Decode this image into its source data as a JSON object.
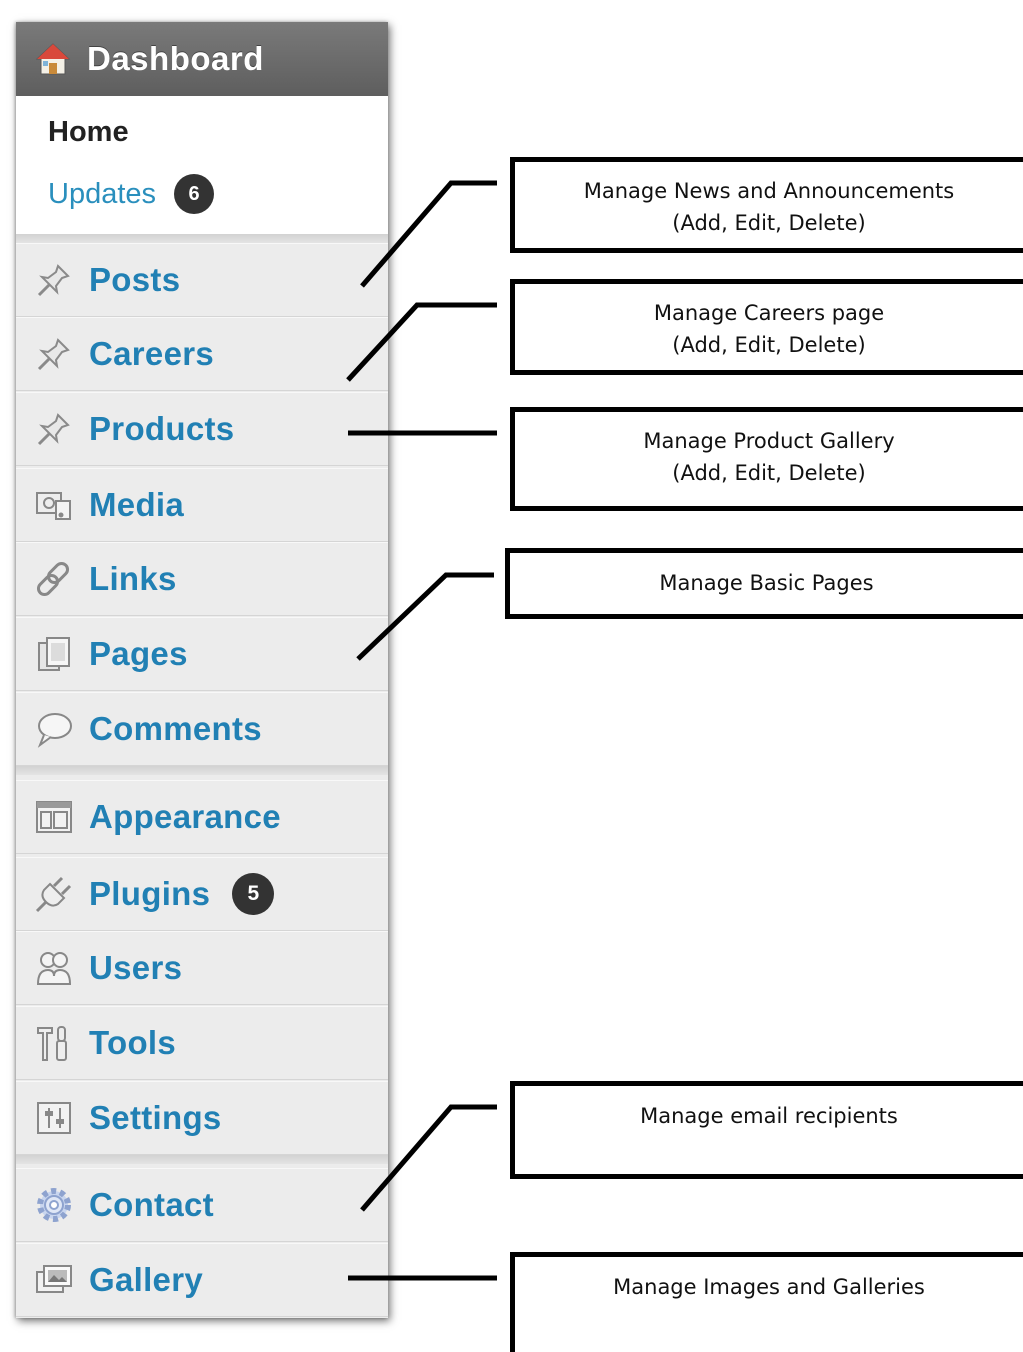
{
  "sidebar": {
    "header": {
      "title": "Dashboard",
      "icon": "home-icon"
    },
    "submenu": {
      "home": "Home",
      "updates": "Updates",
      "updates_badge": "6"
    },
    "items": [
      {
        "label": "Posts",
        "icon": "pushpin-icon"
      },
      {
        "label": "Careers",
        "icon": "pushpin-icon"
      },
      {
        "label": "Products",
        "icon": "pushpin-icon"
      },
      {
        "label": "Media",
        "icon": "media-icon"
      },
      {
        "label": "Links",
        "icon": "links-icon"
      },
      {
        "label": "Pages",
        "icon": "pages-icon"
      },
      {
        "label": "Comments",
        "icon": "comments-icon"
      },
      {
        "label": "Appearance",
        "icon": "appearance-icon"
      },
      {
        "label": "Plugins",
        "icon": "plugins-icon",
        "badge": "5"
      },
      {
        "label": "Users",
        "icon": "users-icon"
      },
      {
        "label": "Tools",
        "icon": "tools-icon"
      },
      {
        "label": "Settings",
        "icon": "settings-icon"
      },
      {
        "label": "Contact",
        "icon": "gear-icon"
      },
      {
        "label": "Gallery",
        "icon": "gallery-icon"
      }
    ]
  },
  "annotations": [
    {
      "line1": "Manage News and Announcements",
      "line2": "(Add, Edit, Delete)"
    },
    {
      "line1": "Manage Careers page",
      "line2": "(Add, Edit, Delete)"
    },
    {
      "line1": "Manage Product Gallery",
      "line2": "(Add, Edit, Delete)"
    },
    {
      "line1": "Manage Basic Pages"
    },
    {
      "line1": "Manage email recipients"
    },
    {
      "line1": "Manage Images and Galleries"
    }
  ],
  "colors": {
    "link": "#2180b4",
    "header_bg": "#6b6b6b",
    "badge_bg": "#333333",
    "menu_bg": "#ececec"
  }
}
